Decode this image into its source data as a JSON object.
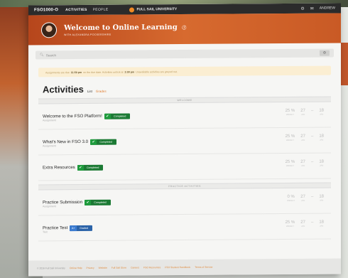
{
  "nav": {
    "course": "FSO1000-O",
    "links": [
      "ACTIVITIES",
      "PEOPLE"
    ],
    "brand": "FULL SAIL UNIVERSITY",
    "user": "ANDREW"
  },
  "banner": {
    "title": "Welcome to Online Learning",
    "subtitle": "WITH ALEXANDRA POCKERSHIRE"
  },
  "search": {
    "placeholder": "Search"
  },
  "notice": {
    "text_a": "Assignments are due",
    "time_a": "11:59 pm",
    "text_b": "on the due date. Activities unlock at",
    "time_b": "2:00 pm",
    "text_c": "Unavailable activities are greyed out."
  },
  "activities": {
    "heading": "Activities",
    "view_list": "List",
    "view_grades": "Grades",
    "sections": [
      "WELCOME",
      "PRACTICE ACTIVITIES"
    ],
    "rows": [
      {
        "name": "Welcome to the FSO Platform!",
        "type": "Assignment",
        "status": "Completed",
        "score": "25 %",
        "due": "27",
        "dash": "–",
        "end": "18"
      },
      {
        "name": "What's New in FSO 3.0",
        "type": "Assignment",
        "status": "Completed",
        "score": "25 %",
        "due": "27",
        "dash": "–",
        "end": "18"
      },
      {
        "name": "Extra Resources",
        "type": "",
        "status": "Completed",
        "score": "25 %",
        "due": "27",
        "dash": "–",
        "end": "18"
      },
      {
        "name": "Practice Submission",
        "type": "Assignment",
        "status": "Completed",
        "score": "0 %",
        "due": "27",
        "dash": "–",
        "end": "18"
      },
      {
        "name": "Practice Test",
        "type": "Test",
        "status": "Graded",
        "grade": "A+",
        "score": "25 %",
        "due": "27",
        "dash": "–",
        "end": "18"
      }
    ],
    "meta_labels": {
      "score": "WEIGHT",
      "due": "JAN",
      "end": "JAN"
    }
  },
  "footer": {
    "copyright": "© 2016 Full Sail University",
    "links": [
      "Online Help",
      "Privacy",
      "Website",
      "Full Sail Store",
      "Careers",
      "FSO Resources",
      "FSO Student Handbook",
      "Terms of Service"
    ]
  },
  "colors": {
    "accent": "#d76a2f",
    "completed": "#1c7a34",
    "graded": "#2b63a8"
  }
}
